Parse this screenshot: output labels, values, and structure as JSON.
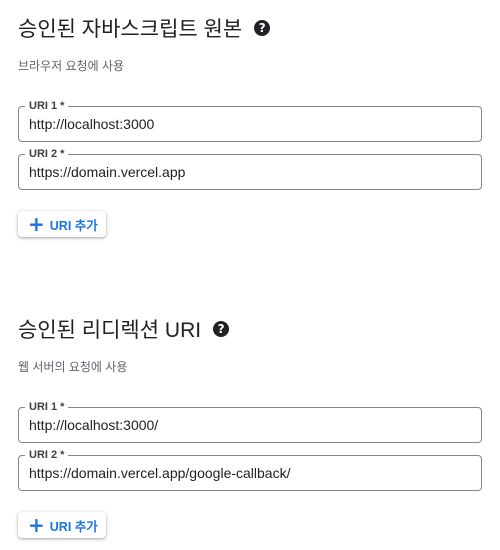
{
  "origins": {
    "title": "승인된 자바스크립트 원본",
    "description": "브라우저 요청에 사용",
    "fields": [
      {
        "label": "URI 1 *",
        "value": "http://localhost:3000"
      },
      {
        "label": "URI 2 *",
        "value": "https://domain.vercel.app"
      }
    ],
    "add_button": "URI 추가"
  },
  "redirects": {
    "title": "승인된 리디렉션 URI",
    "description": "웹 서버의 요청에 사용",
    "fields": [
      {
        "label": "URI 1 *",
        "value": "http://localhost:3000/"
      },
      {
        "label": "URI 2 *",
        "value": "https://domain.vercel.app/google-callback/"
      }
    ],
    "add_button": "URI 추가"
  },
  "icons": {
    "help": "help-circle-icon",
    "add": "plus-icon"
  },
  "colors": {
    "accent": "#1a73e8",
    "text": "#202124",
    "border": "#80868b"
  }
}
